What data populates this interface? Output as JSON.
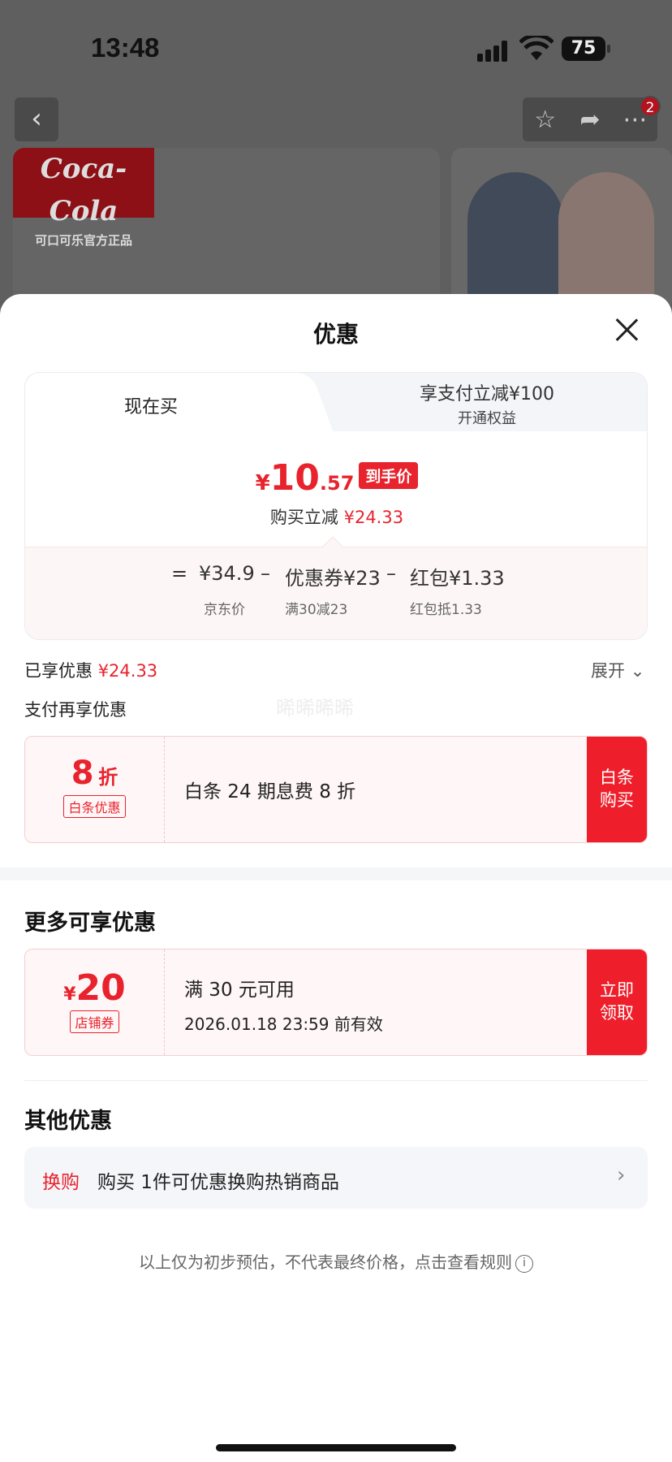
{
  "status": {
    "time": "13:48",
    "battery": "75"
  },
  "bg_page": {
    "badge_count": "2",
    "brand_logo": "Coca-Cola",
    "brand_subtitle": "可口可乐官方正品"
  },
  "sheet": {
    "title": "优惠",
    "tabs": {
      "active": "现在买",
      "other_line1": "享支付立减¥100",
      "other_line2": "开通权益"
    },
    "price": {
      "currency": "¥",
      "integer": "10",
      "decimal": ".57",
      "tag": "到手价",
      "save_label": "购买立减",
      "save_value": "¥24.33"
    },
    "calc": {
      "eq": "=",
      "base": "¥34.9",
      "base_label": "京东价",
      "minus1": "–",
      "coupon": "优惠券¥23",
      "coupon_label": "满30减23",
      "minus2": "–",
      "redpacket": "红包¥1.33",
      "redpacket_label": "红包抵1.33"
    },
    "enjoyed_label": "已享优惠",
    "enjoyed_value": "¥24.33",
    "expand_label": "展开",
    "pay_more_label": "支付再享优惠",
    "watermark": "晞晞晞晞",
    "baitiao": {
      "discount": "8",
      "discount_unit": "折",
      "tag": "白条优惠",
      "desc": "白条 24 期息费 8 折",
      "btn_line1": "白条",
      "btn_line2": "购买"
    },
    "more_title": "更多可享优惠",
    "store_coupon": {
      "currency": "¥",
      "amount": "20",
      "tag": "店铺券",
      "cond": "满 30 元可用",
      "valid": "2026.01.18 23:59 前有效",
      "btn_line1": "立即",
      "btn_line2": "领取"
    },
    "other_title": "其他优惠",
    "swap": {
      "label": "换购",
      "text": "购买 1件可优惠换购热销商品"
    },
    "footnote": "以上仅为初步预估，不代表最终价格，点击查看规则"
  }
}
